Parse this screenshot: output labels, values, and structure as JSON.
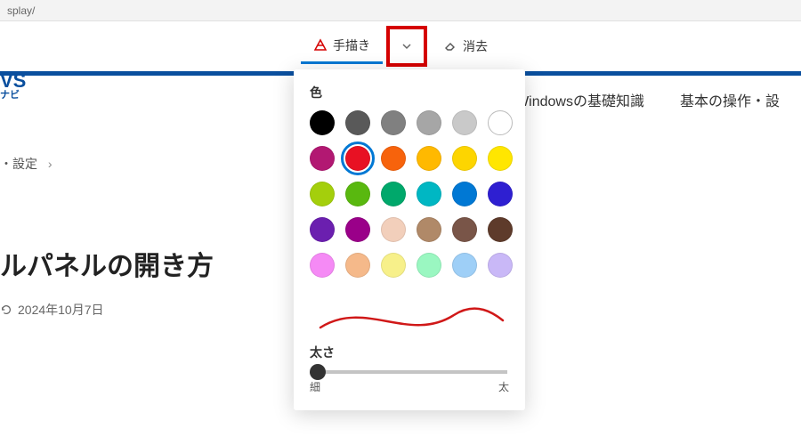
{
  "url_fragment": "splay/",
  "toolbar": {
    "drawing_label": "手描き",
    "erase_label": "消去"
  },
  "nav": {
    "logo_main": "VS",
    "logo_sub": "ナビ",
    "item_basics": "Windowsの基礎知識",
    "item_ops": "基本の操作・設"
  },
  "breadcrumb": {
    "item_settings": "・設定"
  },
  "article": {
    "title_fragment": "ルパネルの開き方",
    "date": "2024年10月7日"
  },
  "popup": {
    "color_heading": "色",
    "thickness_heading": "太さ",
    "thin_label": "細",
    "thick_label": "太",
    "selected_index": 7,
    "colors": [
      "#000000",
      "#595959",
      "#808080",
      "#a6a6a6",
      "#c9c9c9",
      "#ffffff",
      "#b21872",
      "#e81123",
      "#f7630c",
      "#ffb900",
      "#fdd500",
      "#ffe600",
      "#a4cf0c",
      "#59b80f",
      "#00a86b",
      "#00b7c3",
      "#0078d4",
      "#2e1fd1",
      "#6b1faf",
      "#9a0089",
      "#f2cfbb",
      "#b08968",
      "#795548",
      "#5e3b2b",
      "#f58af5",
      "#f5b98a",
      "#f7f08a",
      "#9af7c1",
      "#9ecff7",
      "#c9b8f7"
    ]
  }
}
